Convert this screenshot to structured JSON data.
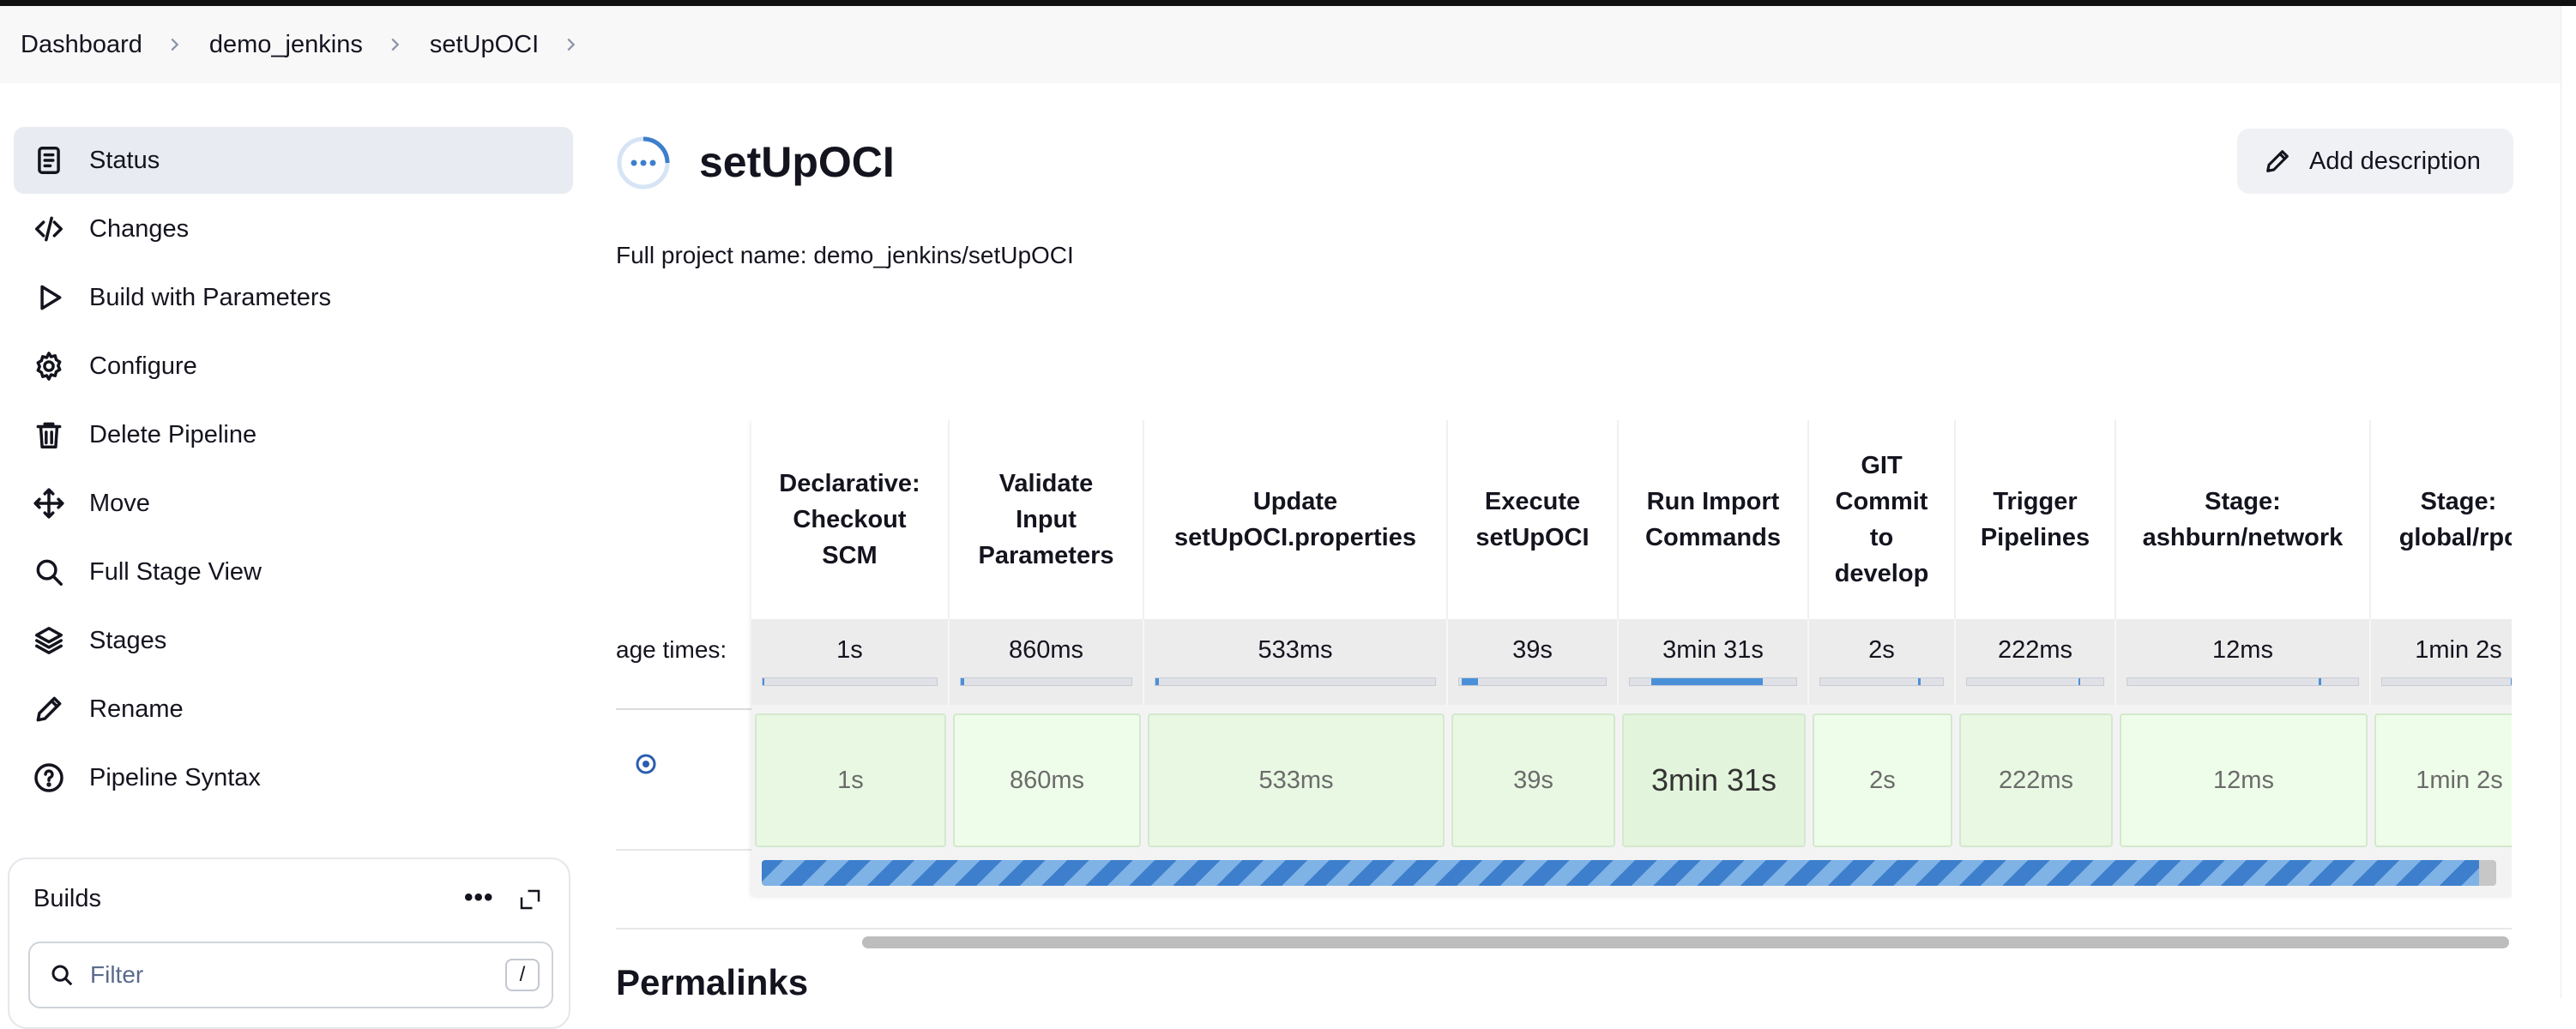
{
  "breadcrumb": [
    "Dashboard",
    "demo_jenkins",
    "setUpOCI"
  ],
  "sidebar": {
    "items": [
      {
        "label": "Status",
        "icon": "document-icon"
      },
      {
        "label": "Changes",
        "icon": "code-icon"
      },
      {
        "label": "Build with Parameters",
        "icon": "play-icon"
      },
      {
        "label": "Configure",
        "icon": "gear-icon"
      },
      {
        "label": "Delete Pipeline",
        "icon": "trash-icon"
      },
      {
        "label": "Move",
        "icon": "move-icon"
      },
      {
        "label": "Full Stage View",
        "icon": "search-icon"
      },
      {
        "label": "Stages",
        "icon": "layers-icon"
      },
      {
        "label": "Rename",
        "icon": "pencil-icon"
      },
      {
        "label": "Pipeline Syntax",
        "icon": "help-icon"
      }
    ]
  },
  "builds": {
    "title": "Builds",
    "more": "•••",
    "filter_placeholder": "Filter",
    "shortcut": "/"
  },
  "main": {
    "title": "setUpOCI",
    "add_description": "Add description",
    "full_name": "Full project name: demo_jenkins/setUpOCI",
    "stage_times_label": "age times:",
    "permalinks": "Permalinks"
  },
  "stages": [
    {
      "name": "Declarative:\nCheckout\nSCM",
      "avg": "1s",
      "run": "1s",
      "avg_fill": [
        0.0,
        0.0
      ]
    },
    {
      "name": "Validate\nInput\nParameters",
      "avg": "860ms",
      "run": "860ms",
      "avg_fill": [
        0.0,
        0.02
      ]
    },
    {
      "name": "Update\nsetUpOCI.properties",
      "avg": "533ms",
      "run": "533ms",
      "avg_fill": [
        0.0,
        0.01
      ]
    },
    {
      "name": "Execute\nsetUpOCI",
      "avg": "39s",
      "run": "39s",
      "avg_fill": [
        0.02,
        0.13
      ]
    },
    {
      "name": "Run Import\nCommands",
      "avg": "3min 31s",
      "run": "3min 31s",
      "avg_fill": [
        0.13,
        0.8
      ]
    },
    {
      "name": "GIT\nCommit\nto\ndevelop",
      "avg": "2s",
      "run": "2s",
      "avg_fill": [
        0.8,
        0.82
      ]
    },
    {
      "name": "Trigger\nPipelines",
      "avg": "222ms",
      "run": "222ms",
      "avg_fill": [
        0.82,
        0.83
      ]
    },
    {
      "name": "Stage:\nashburn/network",
      "avg": "12ms",
      "run": "12ms",
      "avg_fill": [
        0.83,
        0.84
      ]
    },
    {
      "name": "Stage:\nglobal/rpc",
      "avg": "1min 2s",
      "run": "1min 2s",
      "avg_fill": [
        0.84,
        1.0
      ]
    }
  ],
  "run_progress": 0.99,
  "colors": {
    "accent": "#4a90d9",
    "success_cell": "#e8f8e3"
  }
}
